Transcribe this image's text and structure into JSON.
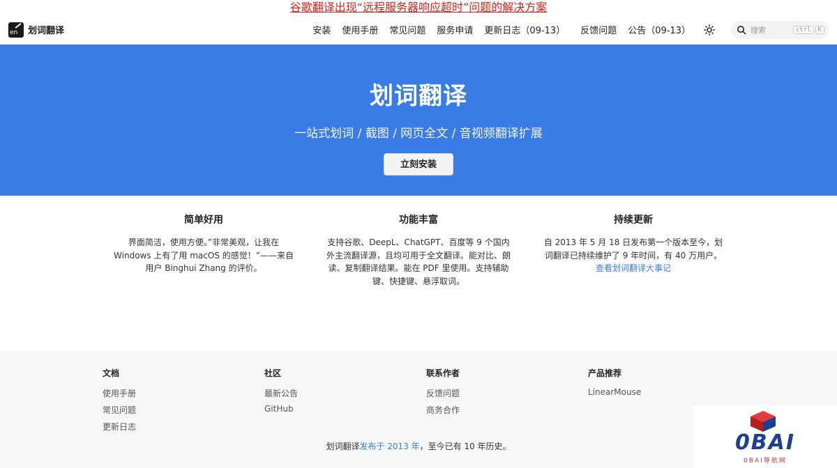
{
  "banner": {
    "text": "谷歌翻译出现“远程服务器响应超时”问题的解决方案"
  },
  "brand": {
    "logo_text": "en",
    "name": "划词翻译"
  },
  "nav": {
    "install": "安装",
    "manual": "使用手册",
    "faq": "常见问题",
    "service": "服务申请",
    "changelog": "更新日志（09-13）",
    "feedback": "反馈问题",
    "notice": "公告（09-13）"
  },
  "search": {
    "placeholder": "搜索",
    "kbd_ctrl": "ctrl",
    "kbd_k": "K"
  },
  "hero": {
    "title": "划词翻译",
    "subtitle": "一站式划词 / 截图 / 网页全文 / 音视频翻译扩展",
    "button": "立刻安装"
  },
  "features": [
    {
      "title": "简单好用",
      "text": "界面简洁，使用方便。”非常美观，让我在 Windows 上有了用 macOS 的感觉！”——来自用户 Binghui Zhang 的评价。"
    },
    {
      "title": "功能丰富",
      "text": "支持谷歌、DeepL、ChatGPT、百度等 9 个国内外主流翻译源，且均可用于全文翻译。能对比、朗读、复制翻译结果。能在 PDF 里使用。支持辅助键、快捷键、悬浮取词。"
    },
    {
      "title": "持续更新",
      "text": "自 2013 年 5 月 18 日发布第一个版本至今，划词翻译已持续维护了 9 年时间，有 40 万用户。",
      "link": "查看划词翻译大事记"
    }
  ],
  "footer": {
    "columns": [
      {
        "title": "文档",
        "links": [
          "使用手册",
          "常见问题",
          "更新日志"
        ]
      },
      {
        "title": "社区",
        "links": [
          "最新公告",
          "GitHub"
        ]
      },
      {
        "title": "联系作者",
        "links": [
          "反馈问题",
          "商务合作"
        ]
      },
      {
        "title": "产品推荐",
        "links": [
          "LinearMouse"
        ]
      }
    ],
    "copyright_prefix": "划词翻译",
    "copyright_link": "发布于 2013 年",
    "copyright_suffix": "，至今已有 10 年历史。"
  },
  "watermark": {
    "text": "0BAI",
    "sub": "0BAI导航网"
  },
  "colors": {
    "accent": "#3a7ce6",
    "banner": "#e0201a",
    "footer_bg": "#f6f7f8"
  }
}
